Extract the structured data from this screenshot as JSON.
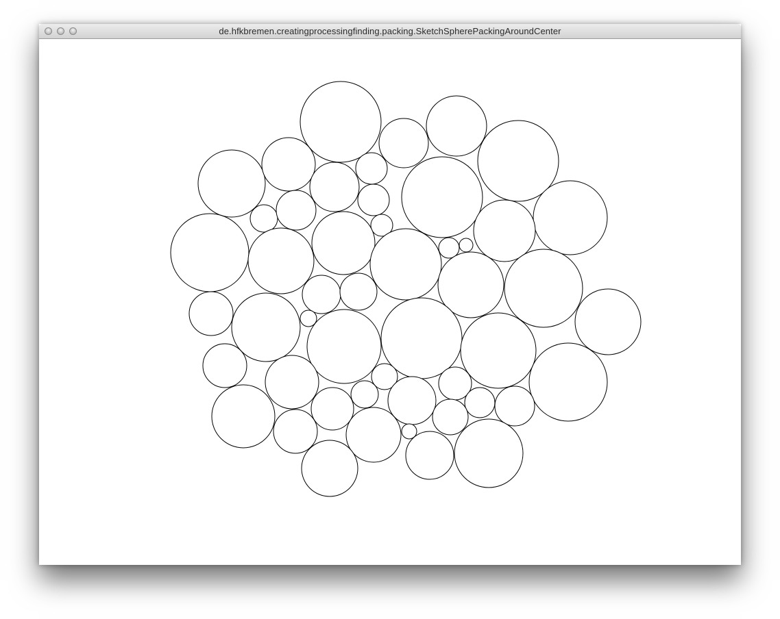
{
  "window": {
    "title": "de.hfkbremen.creatingprocessingfinding.packing.SketchSpherePackingAroundCenter",
    "buttons": [
      "close-button",
      "minimize-button",
      "zoom-button"
    ]
  },
  "sketch": {
    "background": "#ffffff",
    "stroke": "#000000",
    "fill": "#ffffff",
    "circles": [
      [
        497,
        178,
        59
      ],
      [
        589,
        209,
        36
      ],
      [
        666,
        184,
        44
      ],
      [
        756,
        235,
        59
      ],
      [
        338,
        268,
        49
      ],
      [
        421,
        240,
        39
      ],
      [
        488,
        273,
        36
      ],
      [
        542,
        246,
        23
      ],
      [
        645,
        288,
        59
      ],
      [
        545,
        292,
        23
      ],
      [
        832,
        318,
        54
      ],
      [
        385,
        319,
        20
      ],
      [
        432,
        307,
        29
      ],
      [
        557,
        329,
        16
      ],
      [
        736,
        337,
        45
      ],
      [
        306,
        369,
        57
      ],
      [
        410,
        381,
        48
      ],
      [
        501,
        355,
        46
      ],
      [
        592,
        386,
        52
      ],
      [
        655,
        362,
        15
      ],
      [
        680,
        358,
        10
      ],
      [
        687,
        416,
        48
      ],
      [
        793,
        421,
        57
      ],
      [
        469,
        430,
        28
      ],
      [
        523,
        426,
        27
      ],
      [
        308,
        458,
        32
      ],
      [
        388,
        478,
        50
      ],
      [
        450,
        465,
        12
      ],
      [
        502,
        506,
        54
      ],
      [
        615,
        494,
        59
      ],
      [
        727,
        512,
        55
      ],
      [
        887,
        470,
        48
      ],
      [
        328,
        534,
        32
      ],
      [
        426,
        558,
        39
      ],
      [
        561,
        550,
        19
      ],
      [
        532,
        576,
        20
      ],
      [
        601,
        585,
        35
      ],
      [
        664,
        560,
        24
      ],
      [
        829,
        558,
        57
      ],
      [
        355,
        608,
        46
      ],
      [
        485,
        597,
        31
      ],
      [
        700,
        588,
        22
      ],
      [
        751,
        593,
        29
      ],
      [
        431,
        630,
        32
      ],
      [
        545,
        635,
        40
      ],
      [
        597,
        630,
        11
      ],
      [
        657,
        609,
        26
      ],
      [
        627,
        665,
        35
      ],
      [
        713,
        662,
        50
      ],
      [
        481,
        684,
        41
      ]
    ]
  }
}
